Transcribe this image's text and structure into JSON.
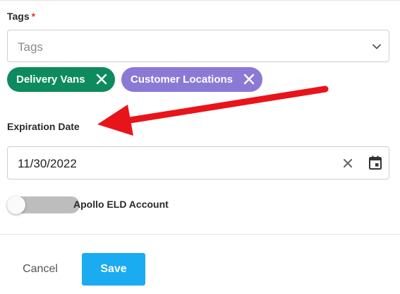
{
  "tags": {
    "label": "Tags",
    "required_mark": "*",
    "placeholder": "Tags",
    "chips": [
      {
        "label": "Delivery Vans",
        "color": "#0e8a5f"
      },
      {
        "label": "Customer Locations",
        "color": "#8a7ad6"
      }
    ]
  },
  "expiration": {
    "label": "Expiration Date",
    "value": "11/30/2022"
  },
  "eld": {
    "label": "Apollo ELD Account",
    "enabled": false
  },
  "actions": {
    "cancel_label": "Cancel",
    "save_label": "Save",
    "save_color": "#1aabf0"
  },
  "annotation": {
    "arrow_color": "#e8141a"
  },
  "icons": {
    "chevron": "chevron-down-icon",
    "chip_remove": "close-icon",
    "clear": "close-icon",
    "calendar": "calendar-icon"
  }
}
